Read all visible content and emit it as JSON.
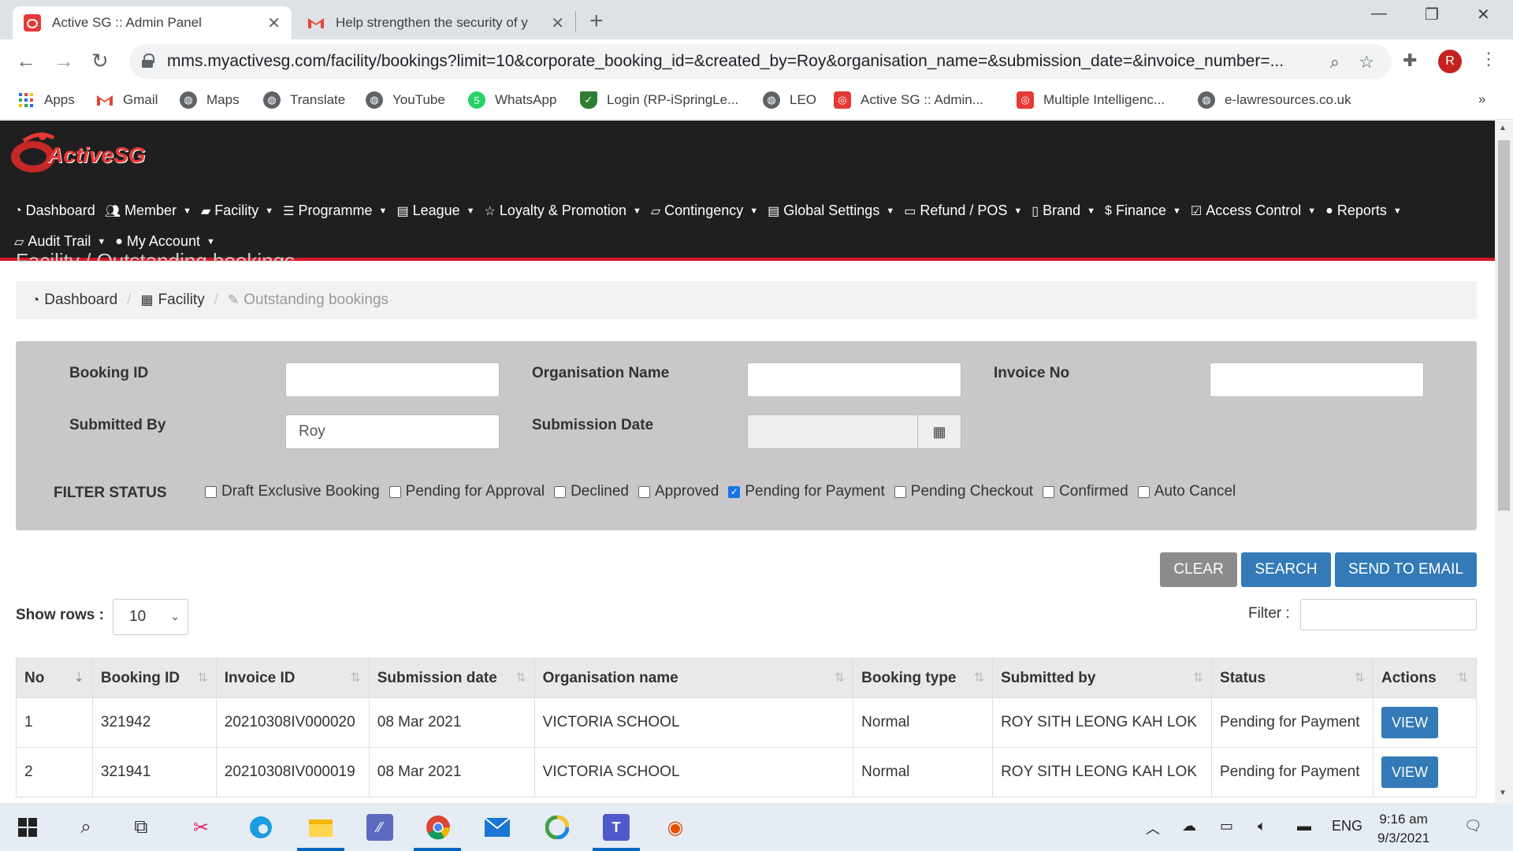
{
  "browser": {
    "tabs": [
      {
        "title": "Active SG :: Admin Panel",
        "icon": "activesg-favicon"
      },
      {
        "title": "Help strengthen the security of y",
        "icon": "gmail-favicon"
      }
    ],
    "url": "mms.myactivesg.com/facility/bookings?limit=10&corporate_booking_id=&created_by=Roy&organisation_name=&submission_date=&invoice_number=...",
    "avatar_letter": "R",
    "bookmarks": [
      {
        "label": "Apps",
        "icon": "apps-grid-icon"
      },
      {
        "label": "Gmail",
        "icon": "gmail-icon"
      },
      {
        "label": "Maps",
        "icon": "globe-icon"
      },
      {
        "label": "Translate",
        "icon": "globe-icon"
      },
      {
        "label": "YouTube",
        "icon": "globe-icon"
      },
      {
        "label": "WhatsApp",
        "icon": "whatsapp-icon"
      },
      {
        "label": "Login (RP-iSpringLe...",
        "icon": "shield-icon"
      },
      {
        "label": "LEO",
        "icon": "globe-icon"
      },
      {
        "label": "Active SG :: Admin...",
        "icon": "activesg-icon"
      },
      {
        "label": "Multiple Intelligenc...",
        "icon": "activesg-icon"
      },
      {
        "label": "e-lawresources.co.uk",
        "icon": "globe-icon"
      }
    ],
    "more_bookmarks": "»"
  },
  "app": {
    "brand": "ActiveSG",
    "nav": [
      {
        "label": "Dashboard",
        "icon": "dashboard-icon",
        "caret": false
      },
      {
        "label": "Member",
        "icon": "users-icon",
        "caret": true
      },
      {
        "label": "Facility",
        "icon": "folder-icon",
        "caret": true
      },
      {
        "label": "Programme",
        "icon": "list-icon",
        "caret": true
      },
      {
        "label": "League",
        "icon": "document-icon",
        "caret": true
      },
      {
        "label": "Loyalty & Promotion",
        "icon": "star-icon",
        "caret": true
      },
      {
        "label": "Contingency",
        "icon": "folder-open-icon",
        "caret": true
      },
      {
        "label": "Global Settings",
        "icon": "document-icon",
        "caret": true
      },
      {
        "label": "Refund / POS",
        "icon": "card-icon",
        "caret": true
      },
      {
        "label": "Brand",
        "icon": "file-icon",
        "caret": true
      },
      {
        "label": "Finance",
        "icon": "dollar-icon",
        "caret": true
      },
      {
        "label": "Access Control",
        "icon": "check-square-icon",
        "caret": true
      },
      {
        "label": "Reports",
        "icon": "user-icon",
        "caret": true
      },
      {
        "label": "Audit Trail",
        "icon": "folder-open-icon",
        "caret": true
      },
      {
        "label": "My Account",
        "icon": "user-icon",
        "caret": true
      }
    ],
    "ghost_title": "Facility / Outstanding bookings",
    "breadcrumb": {
      "dashboard": "Dashboard",
      "facility": "Facility",
      "current": "Outstanding bookings",
      "separator": "/"
    }
  },
  "filters": {
    "booking_id_label": "Booking ID",
    "booking_id_value": "",
    "organisation_name_label": "Organisation Name",
    "organisation_name_value": "",
    "invoice_no_label": "Invoice No",
    "invoice_no_value": "",
    "submitted_by_label": "Submitted By",
    "submitted_by_value": "Roy",
    "submission_date_label": "Submission Date",
    "submission_date_value": "",
    "status_label": "FILTER STATUS",
    "statuses": [
      {
        "label": "Draft Exclusive Booking",
        "checked": false
      },
      {
        "label": "Pending for Approval",
        "checked": false
      },
      {
        "label": "Declined",
        "checked": false
      },
      {
        "label": "Approved",
        "checked": false
      },
      {
        "label": "Pending for Payment",
        "checked": true
      },
      {
        "label": "Pending Checkout",
        "checked": false
      },
      {
        "label": "Confirmed",
        "checked": false
      },
      {
        "label": "Auto Cancel",
        "checked": false
      }
    ]
  },
  "actions": {
    "clear": "CLEAR",
    "search": "SEARCH",
    "send_email": "SEND TO EMAIL"
  },
  "list_controls": {
    "show_rows_label": "Show rows :",
    "rows_value": "10",
    "filter_label": "Filter :"
  },
  "table": {
    "columns": [
      "No",
      "Booking ID",
      "Invoice ID",
      "Submission date",
      "Organisation name",
      "Booking type",
      "Submitted by",
      "Status",
      "Actions"
    ],
    "rows": [
      {
        "no": "1",
        "booking_id": "321942",
        "invoice_id": "20210308IV000020",
        "submission_date": "08 Mar 2021",
        "organisation": "VICTORIA SCHOOL",
        "booking_type": "Normal",
        "submitted_by": "ROY SITH LEONG KAH LOK",
        "status": "Pending for Payment",
        "action": "VIEW"
      },
      {
        "no": "2",
        "booking_id": "321941",
        "invoice_id": "20210308IV000019",
        "submission_date": "08 Mar 2021",
        "organisation": "VICTORIA SCHOOL",
        "booking_type": "Normal",
        "submitted_by": "ROY SITH LEONG KAH LOK",
        "status": "Pending for Payment",
        "action": "VIEW"
      }
    ]
  },
  "taskbar": {
    "time": "9:16 am",
    "date": "9/3/2021",
    "language": "ENG"
  },
  "colors": {
    "header_bg": "#1f1f1f",
    "accent_red": "#d4182a",
    "primary_blue": "#337ab7",
    "clear_gray": "#8c8c8c",
    "filter_panel": "#c8c8c8"
  }
}
